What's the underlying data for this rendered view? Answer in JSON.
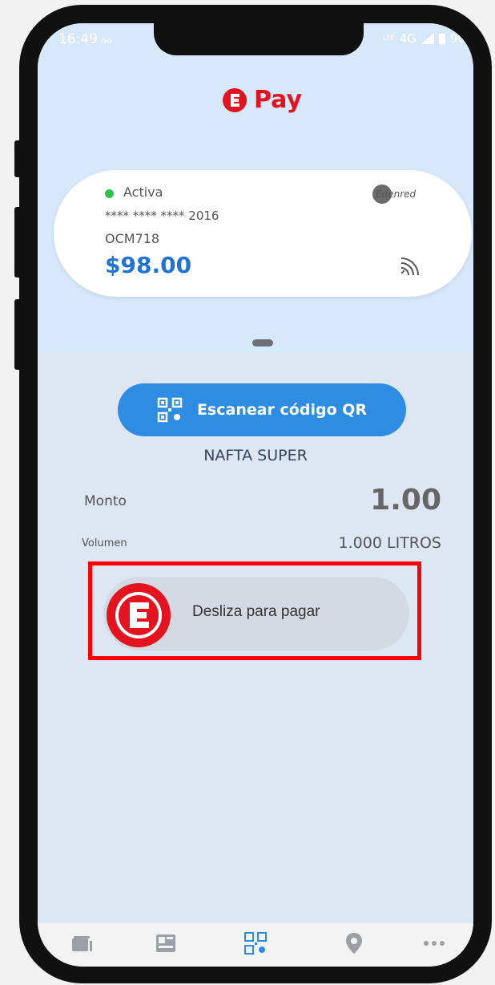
{
  "status_bar": {
    "time": "16:49",
    "left_extra": "oo",
    "right_small": "LTE",
    "network": "4G",
    "battery": "90"
  },
  "brand": {
    "name": "Pay"
  },
  "card": {
    "status": "Activa",
    "masked_number": "**** **** **** 2016",
    "plate": "OCM718",
    "balance": "$98.00",
    "issuer_logo_text": "Edenred"
  },
  "scan_button": {
    "label": "Escanear código QR"
  },
  "product": "NAFTA SUPER",
  "amount": {
    "label": "Monto",
    "value": "1.00"
  },
  "volume": {
    "label": "Volumen",
    "value": "1.000 LITROS"
  },
  "slider": {
    "label": "Desliza para pagar"
  },
  "colors": {
    "brand_red": "#e3141f",
    "accent_blue": "#2e8ce3",
    "balance_blue": "#1f73d6",
    "active_green": "#2dc24a",
    "highlight": "#ff0000"
  },
  "tabs": [
    {
      "icon": "cards-icon"
    },
    {
      "icon": "receipts-icon"
    },
    {
      "icon": "qr-icon"
    },
    {
      "icon": "location-pin-icon"
    },
    {
      "icon": "more-dots-icon"
    }
  ]
}
